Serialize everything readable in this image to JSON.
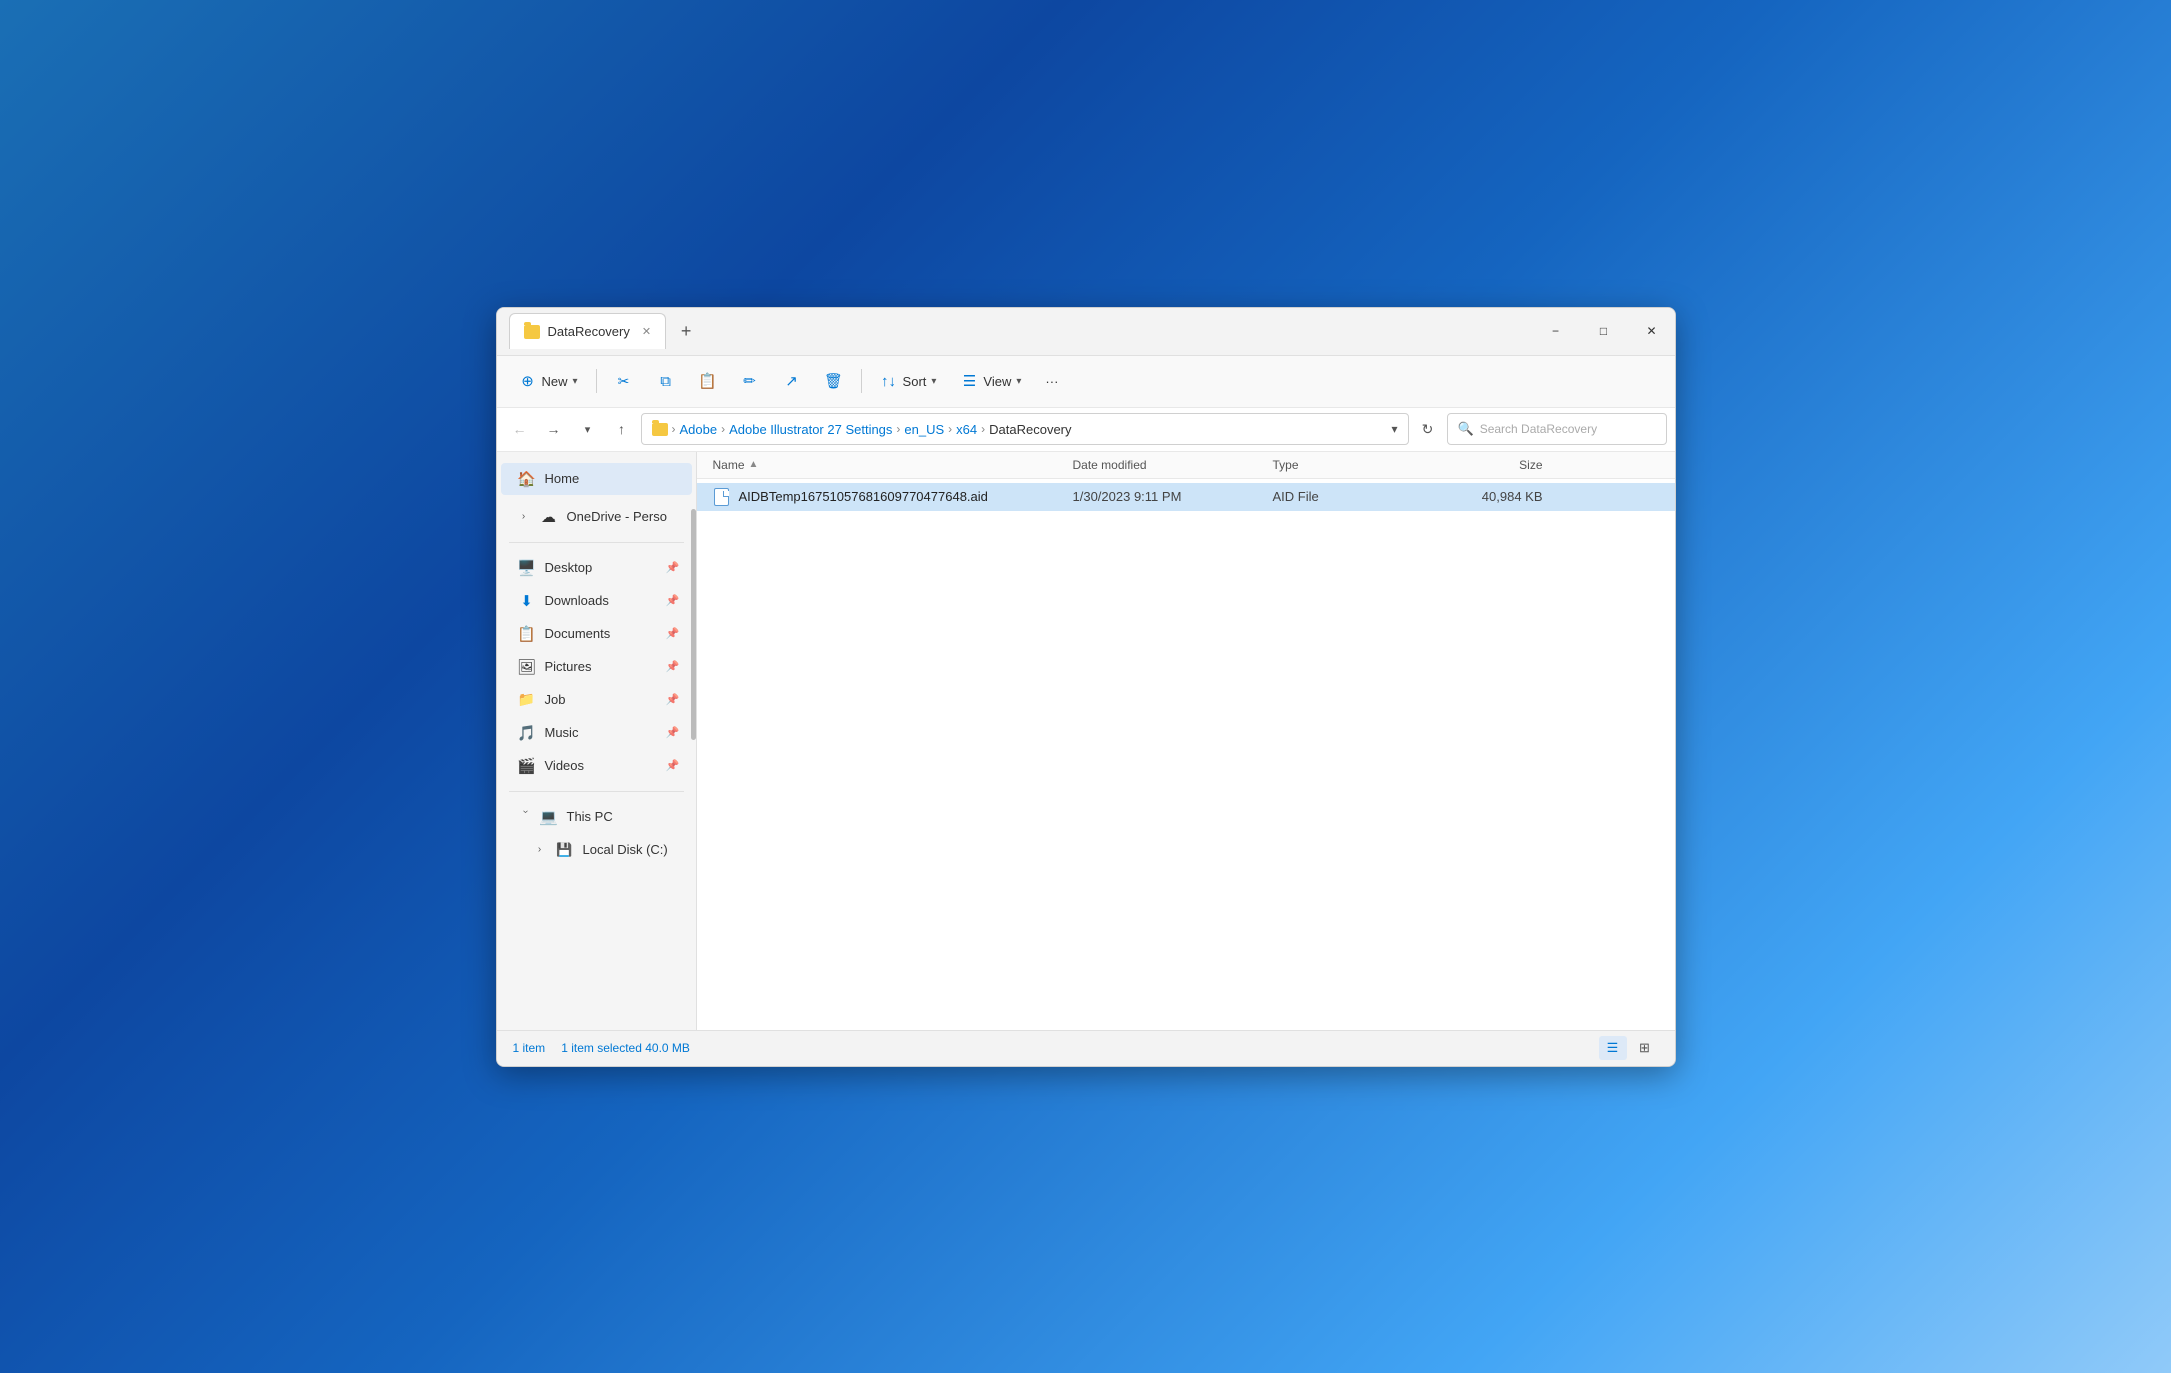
{
  "window": {
    "title": "DataRecovery",
    "tab_label": "DataRecovery"
  },
  "toolbar": {
    "new_label": "New",
    "sort_label": "Sort",
    "view_label": "View",
    "more_label": "···"
  },
  "breadcrumb": {
    "folder_icon": "folder",
    "parts": [
      "Adobe",
      "Adobe Illustrator 27 Settings",
      "en_US",
      "x64",
      "DataRecovery"
    ]
  },
  "search": {
    "placeholder": "Search DataRecovery"
  },
  "sidebar": {
    "home_label": "Home",
    "onedrive_label": "OneDrive - Perso",
    "items": [
      {
        "label": "Desktop",
        "icon": "🖥️",
        "pinned": true
      },
      {
        "label": "Downloads",
        "icon": "⬇️",
        "pinned": true
      },
      {
        "label": "Documents",
        "icon": "📋",
        "pinned": true
      },
      {
        "label": "Pictures",
        "icon": "🖼️",
        "pinned": true
      },
      {
        "label": "Job",
        "icon": "📁",
        "pinned": true
      },
      {
        "label": "Music",
        "icon": "🎵",
        "pinned": true
      },
      {
        "label": "Videos",
        "icon": "🎬",
        "pinned": true
      }
    ],
    "this_pc_label": "This PC",
    "local_disk_label": "Local Disk (C:)"
  },
  "columns": {
    "name": "Name",
    "date_modified": "Date modified",
    "type": "Type",
    "size": "Size"
  },
  "files": [
    {
      "name": "AIDBTemp16751057681609770477648.aid",
      "date_modified": "1/30/2023 9:11 PM",
      "type": "AID File",
      "size": "40,984 KB",
      "selected": true
    }
  ],
  "status_bar": {
    "item_count": "1 item",
    "selection_info": "1 item selected  40.0 MB"
  },
  "window_controls": {
    "minimize": "−",
    "maximize": "□",
    "close": "✕"
  }
}
